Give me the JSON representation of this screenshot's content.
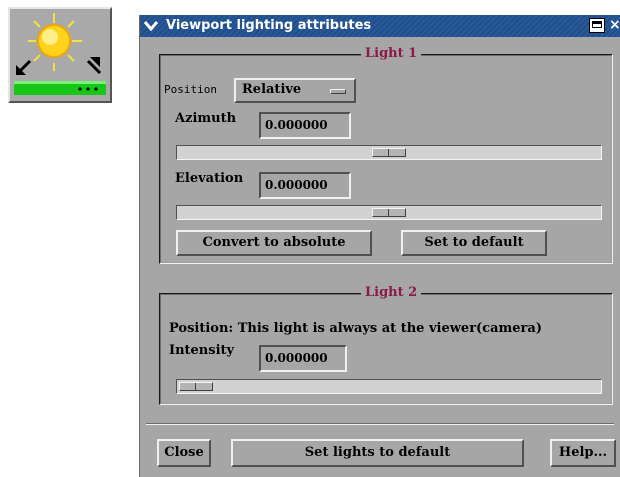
{
  "toolbar_icon": {
    "icon": "sun-light-arrows-icon"
  },
  "window": {
    "title": "Viewport lighting attributes",
    "menu_icon": "chevron-down-icon",
    "maximize_icon": "maximize-icon",
    "close_glyph": "×"
  },
  "light1": {
    "title": "Light 1",
    "position_label": "Position",
    "position_value": "Relative",
    "azimuth_label": "Azimuth",
    "azimuth_value": "0.000000",
    "azimuth_slider_fraction": 0.5,
    "elevation_label": "Elevation",
    "elevation_value": "0.000000",
    "elevation_slider_fraction": 0.5,
    "convert_button": "Convert to absolute",
    "default_button": "Set to default"
  },
  "light2": {
    "title": "Light 2",
    "position_text": "Position: This light is always at the viewer(camera)",
    "intensity_label": "Intensity",
    "intensity_value": "0.000000",
    "intensity_slider_fraction": 0.0
  },
  "footer": {
    "close_button": "Close",
    "set_lights_button": "Set lights to default",
    "help_button": "Help..."
  },
  "colors": {
    "title_bar": "#1e4f8e",
    "group_title": "#8b1a4a",
    "panel_bg": "#a6a6a6"
  }
}
